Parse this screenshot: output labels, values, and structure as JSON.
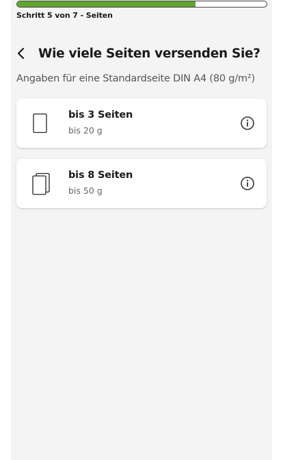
{
  "progress": {
    "value": 0.714,
    "step_label": "Schritt 5 von 7 - Seiten"
  },
  "header": {
    "back_icon": "chevron-left-icon",
    "title": "Wie viele Seiten versenden Sie?"
  },
  "subtitle": "Angaben für eine Standardseite DIN A4 (80 g/m²)",
  "options": [
    {
      "title": "bis 3 Seiten",
      "weight": "bis 20 g",
      "icon": "single-page-icon",
      "info_icon": "info-icon"
    },
    {
      "title": "bis 8 Seiten",
      "weight": "bis 50 g",
      "icon": "stacked-pages-icon",
      "info_icon": "info-icon"
    }
  ],
  "colors": {
    "progress_fill": "#5fa630",
    "background": "#f4f4f4",
    "card": "#ffffff",
    "text": "#1a1a1a"
  }
}
